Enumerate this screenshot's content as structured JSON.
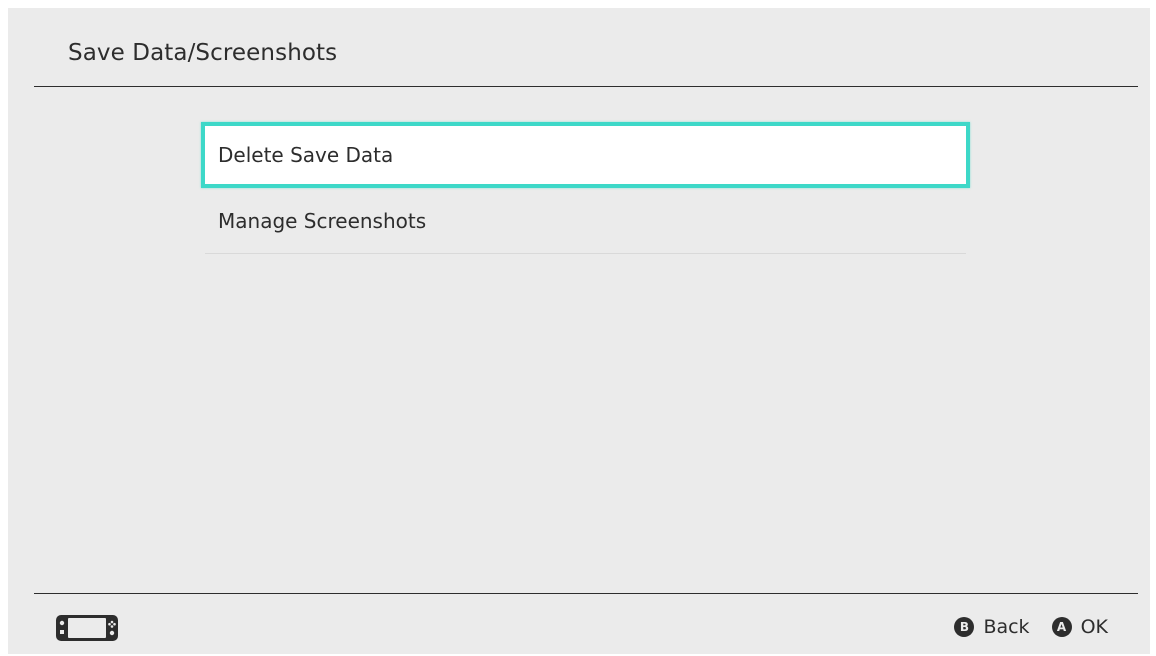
{
  "header": {
    "title": "Save Data/Screenshots"
  },
  "menu": {
    "items": [
      {
        "label": "Delete Save Data",
        "selected": true
      },
      {
        "label": "Manage Screenshots",
        "selected": false
      }
    ]
  },
  "footer": {
    "console_icon": "handheld-console-icon",
    "actions": [
      {
        "button": "B",
        "label": "Back"
      },
      {
        "button": "A",
        "label": "OK"
      }
    ]
  },
  "colors": {
    "background": "#ebebeb",
    "selection_border": "#3dd8c8",
    "text": "#2d2d2d"
  }
}
